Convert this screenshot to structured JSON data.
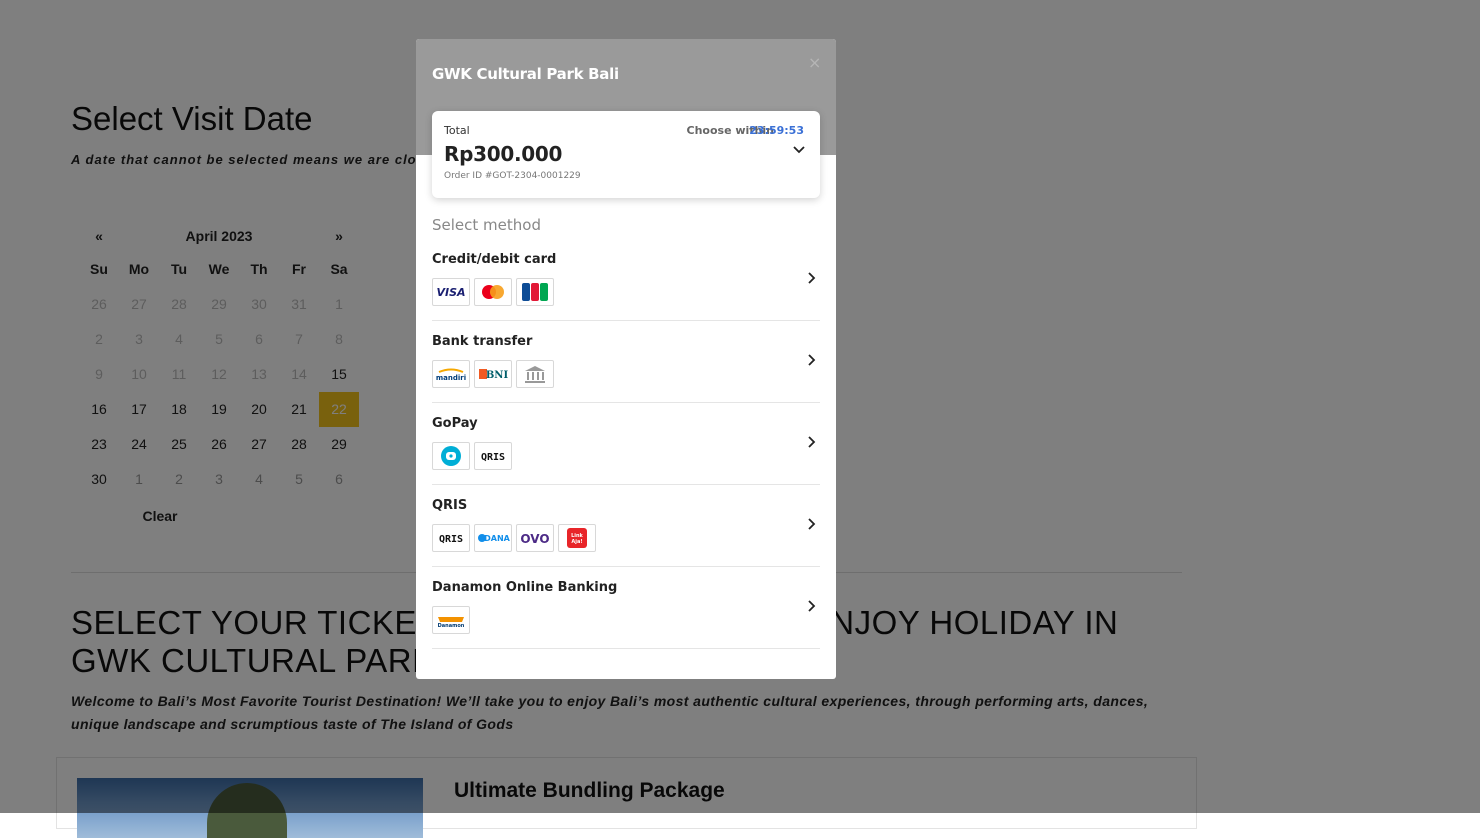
{
  "page": {
    "title": "Select Visit Date",
    "note": "A date that cannot be selected means we are closed",
    "calendar": {
      "prev": "«",
      "next": "»",
      "month_label": "April  2023",
      "weekdays": [
        "Su",
        "Mo",
        "Tu",
        "We",
        "Th",
        "Fr",
        "Sa"
      ],
      "weeks": [
        [
          "26",
          "27",
          "28",
          "29",
          "30",
          "31",
          "1"
        ],
        [
          "2",
          "3",
          "4",
          "5",
          "6",
          "7",
          "8"
        ],
        [
          "9",
          "10",
          "11",
          "12",
          "13",
          "14",
          "15"
        ],
        [
          "16",
          "17",
          "18",
          "19",
          "20",
          "21",
          "22"
        ],
        [
          "23",
          "24",
          "25",
          "26",
          "27",
          "28",
          "29"
        ],
        [
          "30",
          "1",
          "2",
          "3",
          "4",
          "5",
          "6"
        ]
      ],
      "selected_day": "22",
      "clear_label": "Clear"
    },
    "heading": "SELECT YOUR TICKETS AND GET READY TO ENJOY HOLIDAY IN GWK CULTURAL PARK",
    "welcome": "Welcome to Bali’s Most Favorite Tourist Destination! We’ll take you to enjoy Bali’s most authentic cultural experiences, through performing arts, dances, unique landscape and scrumptious taste of The Island of Gods",
    "card_title": "Ultimate Bundling Package"
  },
  "modal": {
    "title": "GWK Cultural Park Bali",
    "close": "×",
    "total_label": "Total",
    "choose_within_label": "Choose within",
    "timer": "23:59:53",
    "amount": "Rp300.000",
    "order_id": "Order ID #GOT-2304-0001229",
    "select_method_label": "Select method",
    "methods": [
      {
        "name": "Credit/debit card",
        "logos": [
          "VISA",
          "mastercard",
          "JCB"
        ]
      },
      {
        "name": "Bank transfer",
        "logos": [
          "mandiri",
          "BNI",
          "bank"
        ]
      },
      {
        "name": "GoPay",
        "logos": [
          "gopay",
          "QRIS"
        ]
      },
      {
        "name": "QRIS",
        "logos": [
          "QRIS",
          "DANA",
          "OVO",
          "LinkAja"
        ]
      },
      {
        "name": "Danamon Online Banking",
        "logos": [
          "Danamon"
        ]
      }
    ]
  },
  "colors": {
    "selected_date": "#f2c21b",
    "timer": "#3a70d6",
    "overlay": "rgba(0,0,0,0.5)",
    "modal_header": "#9a9a9a"
  }
}
